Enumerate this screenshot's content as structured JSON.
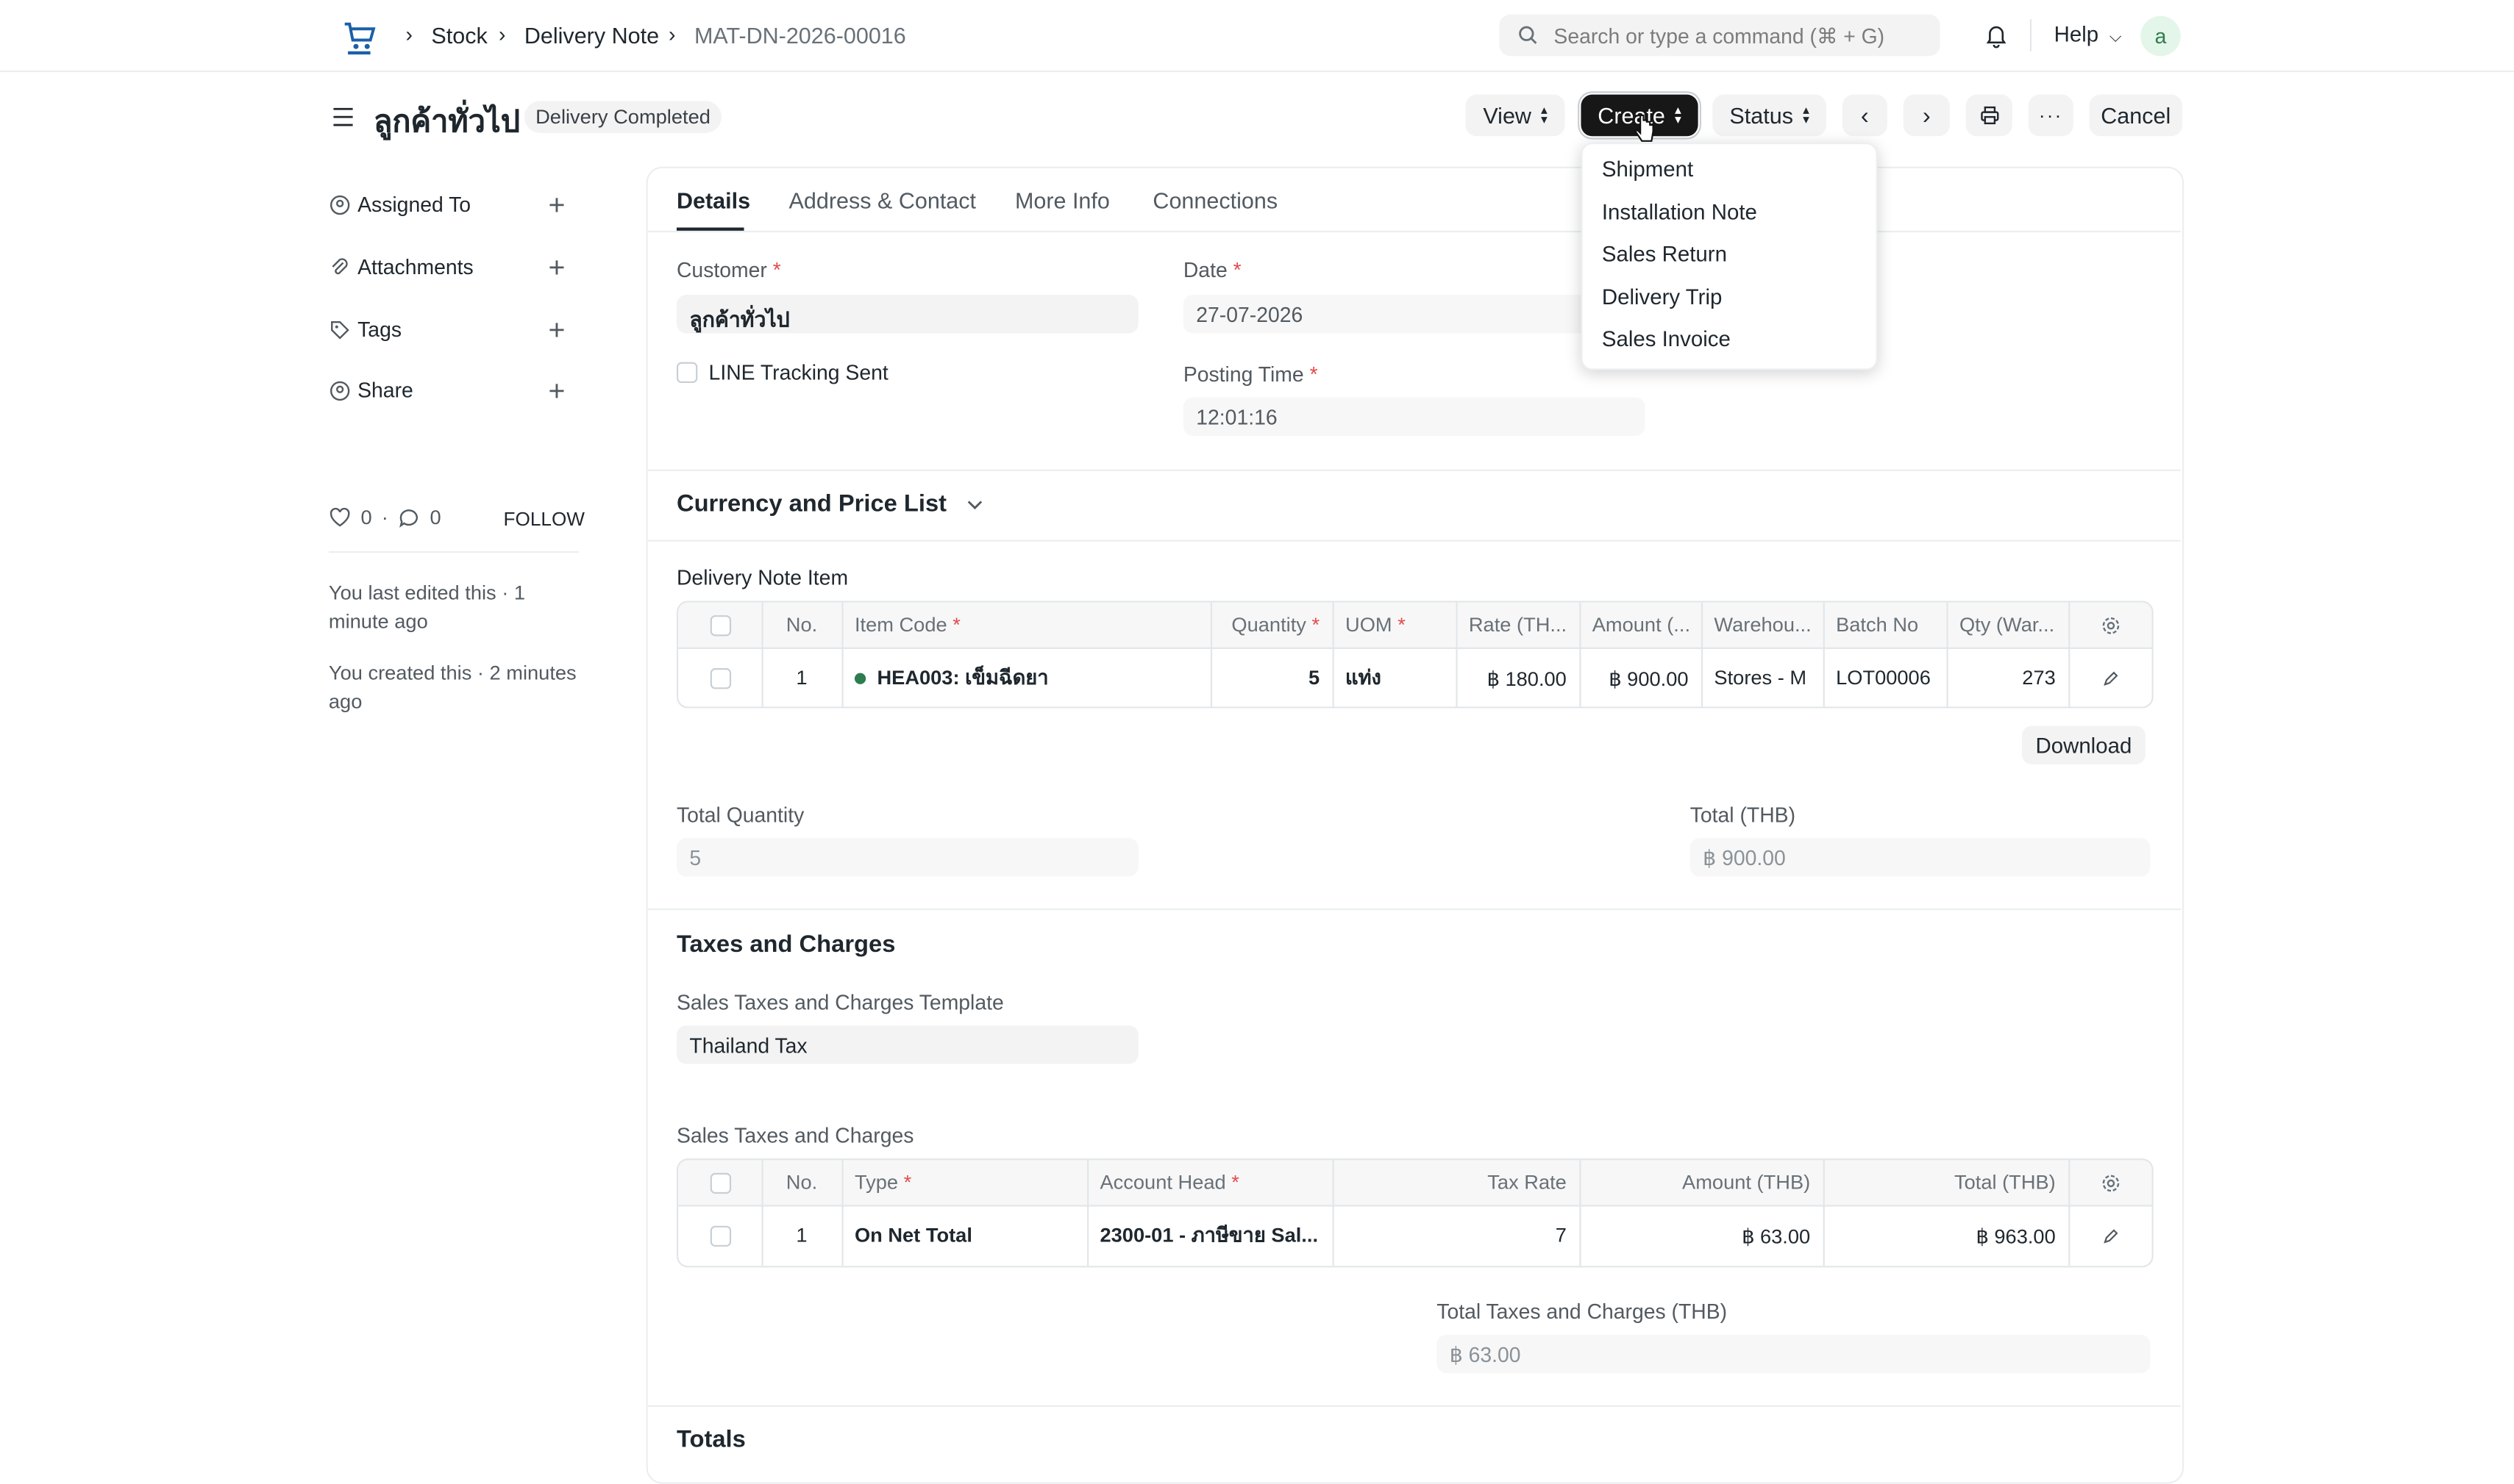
{
  "breadcrumb": {
    "items": [
      "Stock",
      "Delivery Note",
      "MAT-DN-2026-00016"
    ]
  },
  "search": {
    "placeholder": "Search or type a command (⌘ + G)"
  },
  "navbar": {
    "help_label": "Help",
    "avatar_letter": "a"
  },
  "page": {
    "title": "ลูกค้าทั่วไป",
    "status_badge": "Delivery Completed"
  },
  "toolbar": {
    "view_label": "View",
    "create_label": "Create",
    "status_label": "Status",
    "cancel_label": "Cancel"
  },
  "create_menu": {
    "items": [
      "Shipment",
      "Installation Note",
      "Sales Return",
      "Delivery Trip",
      "Sales Invoice"
    ]
  },
  "sidebar": {
    "items": [
      {
        "label": "Assigned To",
        "icon": "assign-icon"
      },
      {
        "label": "Attachments",
        "icon": "paperclip-icon"
      },
      {
        "label": "Tags",
        "icon": "tag-icon"
      },
      {
        "label": "Share",
        "icon": "share-icon"
      }
    ],
    "likes": "0",
    "comments": "0",
    "follow_label": "FOLLOW",
    "last_edited": "You last edited this · 1 minute ago",
    "created": "You created this · 2 minutes ago"
  },
  "tabs": [
    "Details",
    "Address & Contact",
    "More Info",
    "Connections"
  ],
  "details": {
    "customer_label": "Customer",
    "customer_value": "ลูกค้าทั่วไป",
    "line_tracking_label": "LINE Tracking Sent",
    "date_label": "Date",
    "date_value": "27-07-2026",
    "posting_time_label": "Posting Time",
    "posting_time_value": "12:01:16"
  },
  "currency_section": {
    "title": "Currency and Price List"
  },
  "items_table": {
    "title": "Delivery Note Item",
    "headers": [
      "No.",
      "Item Code",
      "Quantity",
      "UOM",
      "Rate (TH...",
      "Amount (...",
      "Warehou...",
      "Batch No",
      "Qty (War..."
    ],
    "rows": [
      {
        "no": "1",
        "item_code": "HEA003: เข็มฉีดยา",
        "quantity": "5",
        "uom": "แท่ง",
        "rate": "฿ 180.00",
        "amount": "฿ 900.00",
        "warehouse": "Stores - M",
        "batch_no": "LOT00006",
        "qty_warehouse": "273"
      }
    ],
    "download_label": "Download"
  },
  "totals_row": {
    "total_quantity_label": "Total Quantity",
    "total_quantity_value": "5",
    "total_label": "Total (THB)",
    "total_value": "฿ 900.00"
  },
  "taxes_section": {
    "title": "Taxes and Charges",
    "template_label": "Sales Taxes and Charges Template",
    "template_value": "Thailand Tax",
    "table_title": "Sales Taxes and Charges",
    "headers": [
      "No.",
      "Type",
      "Account Head",
      "Tax Rate",
      "Amount (THB)",
      "Total (THB)"
    ],
    "rows": [
      {
        "no": "1",
        "type": "On Net Total",
        "account_head": "2300-01 - ภาษีขาย Sal...",
        "tax_rate": "7",
        "amount": "฿ 63.00",
        "total": "฿ 963.00"
      }
    ],
    "total_taxes_label": "Total Taxes and Charges (THB)",
    "total_taxes_value": "฿ 63.00"
  },
  "totals_section": {
    "title": "Totals"
  },
  "colors": {
    "accent_dark": "#171717",
    "required": "#e24c4c",
    "status_dot": "#2e7d4f",
    "avatar_bg": "#e4f5e9",
    "avatar_fg": "#2e7d4f"
  }
}
